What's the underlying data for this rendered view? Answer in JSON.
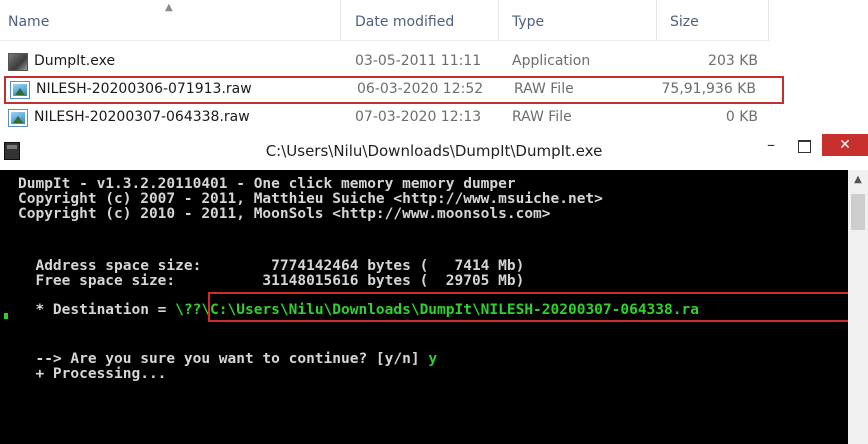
{
  "explorer": {
    "columns": {
      "name": "Name",
      "date": "Date modified",
      "type": "Type",
      "size": "Size"
    },
    "sort_arrow": "▲",
    "files": [
      {
        "name": "DumpIt.exe",
        "date": "03-05-2011 11:11",
        "type": "Application",
        "size": "203 KB",
        "icon": "exe-icon",
        "highlighted": false
      },
      {
        "name": "NILESH-20200306-071913.raw",
        "date": "06-03-2020 12:52",
        "type": "RAW File",
        "size": "75,91,936 KB",
        "icon": "raw-file-icon",
        "highlighted": true
      },
      {
        "name": "NILESH-20200307-064338.raw",
        "date": "07-03-2020 12:13",
        "type": "RAW File",
        "size": "0 KB",
        "icon": "raw-file-icon",
        "highlighted": false
      }
    ]
  },
  "console": {
    "title": "C:\\Users\\Nilu\\Downloads\\DumpIt\\DumpIt.exe",
    "minimize": "–",
    "close": "✕",
    "lines": {
      "l1": "DumpIt - v1.3.2.20110401 - One click memory memory dumper",
      "l2": "Copyright (c) 2007 - 2011, Matthieu Suiche <http://www.msuiche.net>",
      "l3": "Copyright (c) 2010 - 2011, MoonSols <http://www.moonsols.com>",
      "l4": "  Address space size:        7774142464 bytes (   7414 Mb)",
      "l5": "  Free space size:          31148015616 bytes (  29705 Mb)",
      "dest_label": "  * Destination = ",
      "dest_path": "\\??\\C:\\Users\\Nilu\\Downloads\\DumpIt\\NILESH-20200307-064338.ra",
      "prompt": "  --> Are you sure you want to continue? [y/n] ",
      "answer": "y",
      "processing": "  + Processing..."
    }
  },
  "colors": {
    "highlight_border": "#c0302f",
    "terminal_bg": "#000000",
    "terminal_green": "#2fd02f",
    "close_button": "#c7302c"
  }
}
